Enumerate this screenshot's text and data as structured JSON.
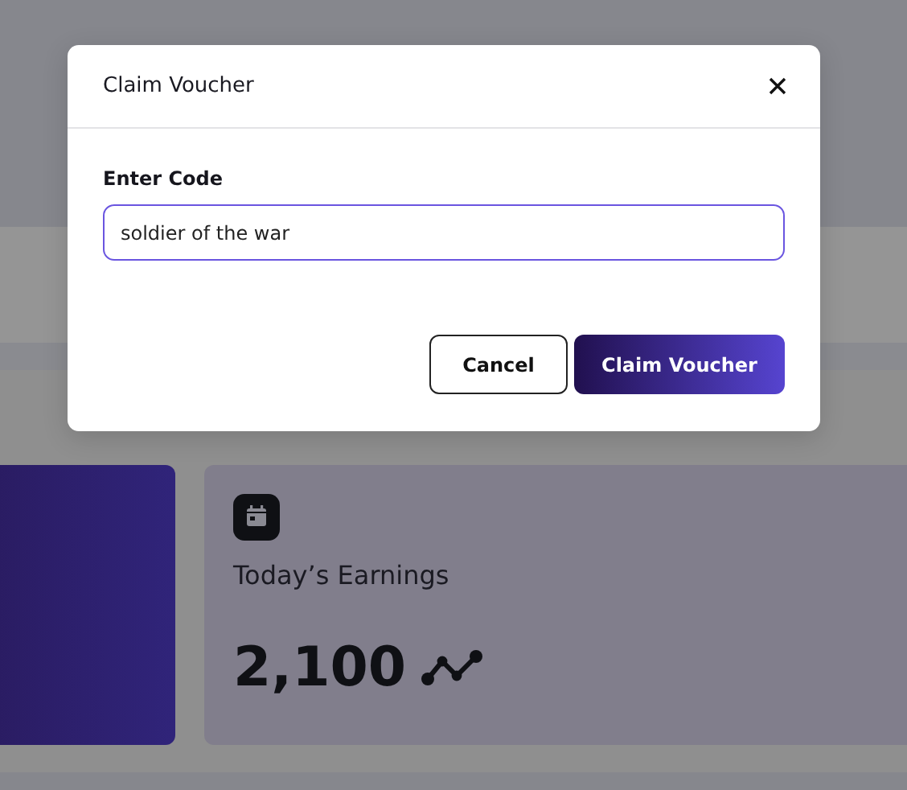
{
  "dialog": {
    "title": "Claim Voucher",
    "field": {
      "label": "Enter Code",
      "value": "soldier of the war"
    },
    "buttons": [
      {
        "label": "Cancel",
        "kind": "secondary"
      },
      {
        "label": "Claim Voucher",
        "kind": "primary"
      }
    ]
  },
  "cards": [
    {
      "kind": "accent"
    },
    {
      "kind": "stat",
      "title": "Today’s Earnings",
      "value": "2,100"
    }
  ]
}
